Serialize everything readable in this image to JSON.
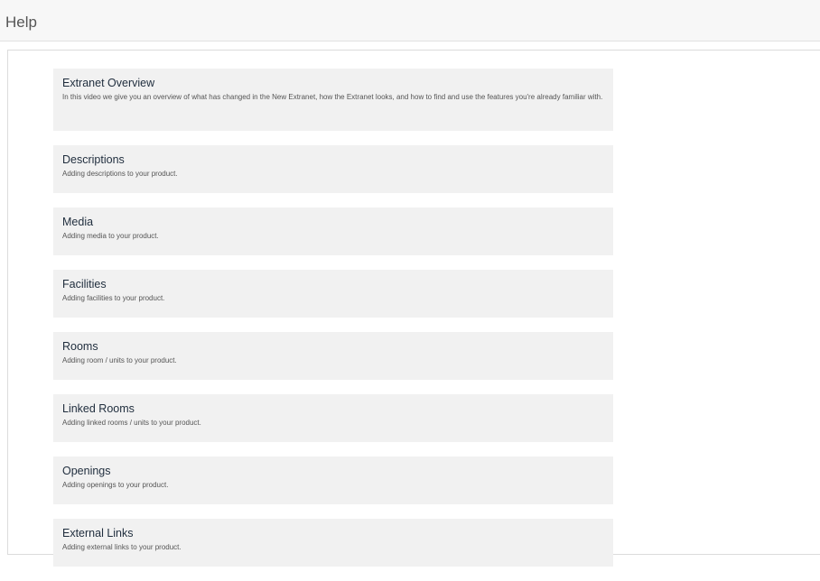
{
  "header": {
    "title": "Help"
  },
  "help_items": [
    {
      "title": "Extranet Overview",
      "description": "In this video we give you an overview of what has changed in the New Extranet, how the Extranet looks, and how to find and use the features you're already familiar with."
    },
    {
      "title": "Descriptions",
      "description": "Adding descriptions to your product."
    },
    {
      "title": "Media",
      "description": "Adding media to your product."
    },
    {
      "title": "Facilities",
      "description": "Adding facilities to your product."
    },
    {
      "title": "Rooms",
      "description": "Adding room / units to your product."
    },
    {
      "title": "Linked Rooms",
      "description": "Adding linked rooms / units to your product."
    },
    {
      "title": "Openings",
      "description": "Adding openings to your product."
    },
    {
      "title": "External Links",
      "description": "Adding external links to your product."
    }
  ]
}
